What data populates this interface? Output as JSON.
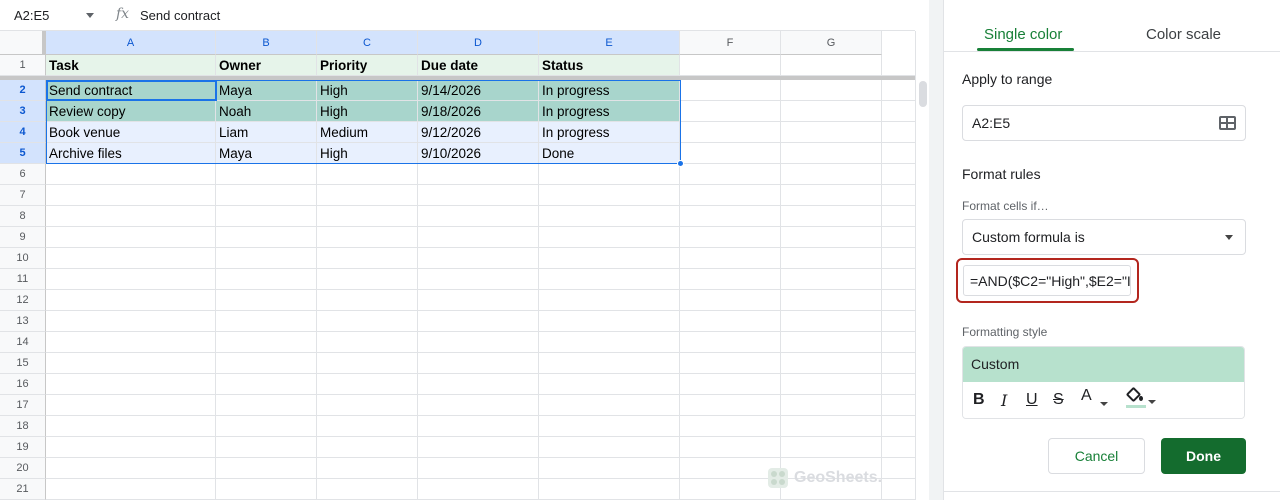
{
  "formula_bar": {
    "name_box": "A2:E5",
    "fx_symbol": "fx",
    "content": "Send contract"
  },
  "columns": [
    "A",
    "B",
    "C",
    "D",
    "E",
    "F",
    "G"
  ],
  "rows": [
    "1",
    "2",
    "3",
    "4",
    "5",
    "6",
    "7",
    "8",
    "9",
    "10",
    "11",
    "12",
    "13",
    "14",
    "15",
    "16",
    "17",
    "18",
    "19",
    "20",
    "21"
  ],
  "header_row": [
    "Task",
    "Owner",
    "Priority",
    "Due date",
    "Status"
  ],
  "data_rows": [
    [
      "Send contract",
      "Maya",
      "High",
      "9/14/2026",
      "In progress"
    ],
    [
      "Review copy",
      "Noah",
      "High",
      "9/18/2026",
      "In progress"
    ],
    [
      "Book venue",
      "Liam",
      "Medium",
      "9/12/2026",
      "In progress"
    ],
    [
      "Archive files",
      "Maya",
      "High",
      "9/10/2026",
      "Done"
    ]
  ],
  "watermark": "GeoSheets.",
  "panel": {
    "tabs": [
      "Single color",
      "Color scale"
    ],
    "apply_to_range_label": "Apply to range",
    "range_value": "A2:E5",
    "format_rules_label": "Format rules",
    "format_cells_if_label": "Format cells if…",
    "condition_value": "Custom formula is",
    "formula_value": "=AND($C2=\"High\",$E2=\"I",
    "formatting_style_label": "Formatting style",
    "style_preview": "Custom",
    "cancel": "Cancel",
    "done": "Done"
  },
  "colors": {
    "highlight_rule": "#a8d5cc",
    "selection_fill": "#e8f0fe",
    "header_fill": "#e6f4ea",
    "style_preview": "#b7e1cd",
    "accent": "#188038",
    "done_button": "#146c2e",
    "formula_outline": "#b3261e"
  }
}
